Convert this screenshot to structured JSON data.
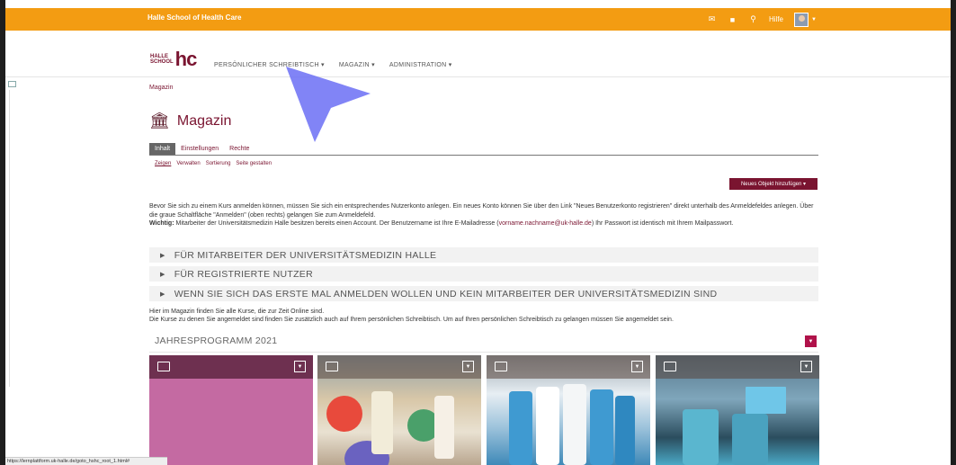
{
  "topbar": {
    "brand": "Halle School of Health Care",
    "help_label": "Hilfe",
    "icons": [
      "mail-icon",
      "chat-icon",
      "search-icon"
    ]
  },
  "logo": {
    "line1": "HALLE",
    "line2": "SCHOOL",
    "mark": "hc"
  },
  "nav": [
    "PERSÖNLICHER SCHREIBTISCH ▾",
    "MAGAZIN ▾",
    "ADMINISTRATION ▾"
  ],
  "breadcrumb": "Magazin",
  "page": {
    "title": "Magazin"
  },
  "tabs": [
    "Inhalt",
    "Einstellungen",
    "Rechte"
  ],
  "subtabs": [
    "Zeigen",
    "Verwalten",
    "Sortierung",
    "Seite gestalten"
  ],
  "add_button": "Neues Objekt hinzufügen ▾",
  "intro": {
    "p1": "Bevor Sie sich zu einem Kurs anmelden können, müssen Sie sich ein entsprechendes Nutzerkonto anlegen. Ein neues Konto können Sie über den Link \"Neues Benutzerkonto registrieren\" direkt unterhalb des Anmeldefeldes anlegen. Über die graue Schaltfläche \"Anmelden\" (oben rechts) gelangen Sie zum Anmeldefeld.",
    "important_label": "Wichtig:",
    "p2_before": " Mitarbeiter der Universitätsmedizin Halle besitzen bereits einen Account. Der Benutzername ist Ihre E-Mailadresse (",
    "email": "vorname.nachname@uk-halle.de",
    "p2_after": ") Ihr Passwort ist identisch mit Ihrem Mailpasswort."
  },
  "accordions": [
    "FÜR MITARBEITER DER UNIVERSITÄTSMEDIZIN HALLE",
    "FÜR REGISTRIERTE NUTZER",
    "WENN SIE SICH DAS ERSTE MAL ANMELDEN WOLLEN UND KEIN MITARBEITER DER UNIVERSITÄTSMEDIZIN SIND"
  ],
  "info": {
    "line1": "Hier im Magazin finden Sie alle Kurse, die zur Zeit Online sind.",
    "line2": "Die Kurse zu denen Sie angemeldet sind finden Sie zusätzlich auch auf Ihrem persönlichen Schreibtisch. Um auf Ihren persönlichen Schreibtisch zu gelangen müssen Sie angemeldet sein."
  },
  "section": {
    "title": "JAHRESPROGRAMM 2021"
  },
  "status_url": "https://lernplattform.uk-halle.de/goto_hshc_root_1.html#",
  "colors": {
    "topbar": "#f39c12",
    "accent": "#7a1430",
    "dropdown": "#b0124a"
  }
}
